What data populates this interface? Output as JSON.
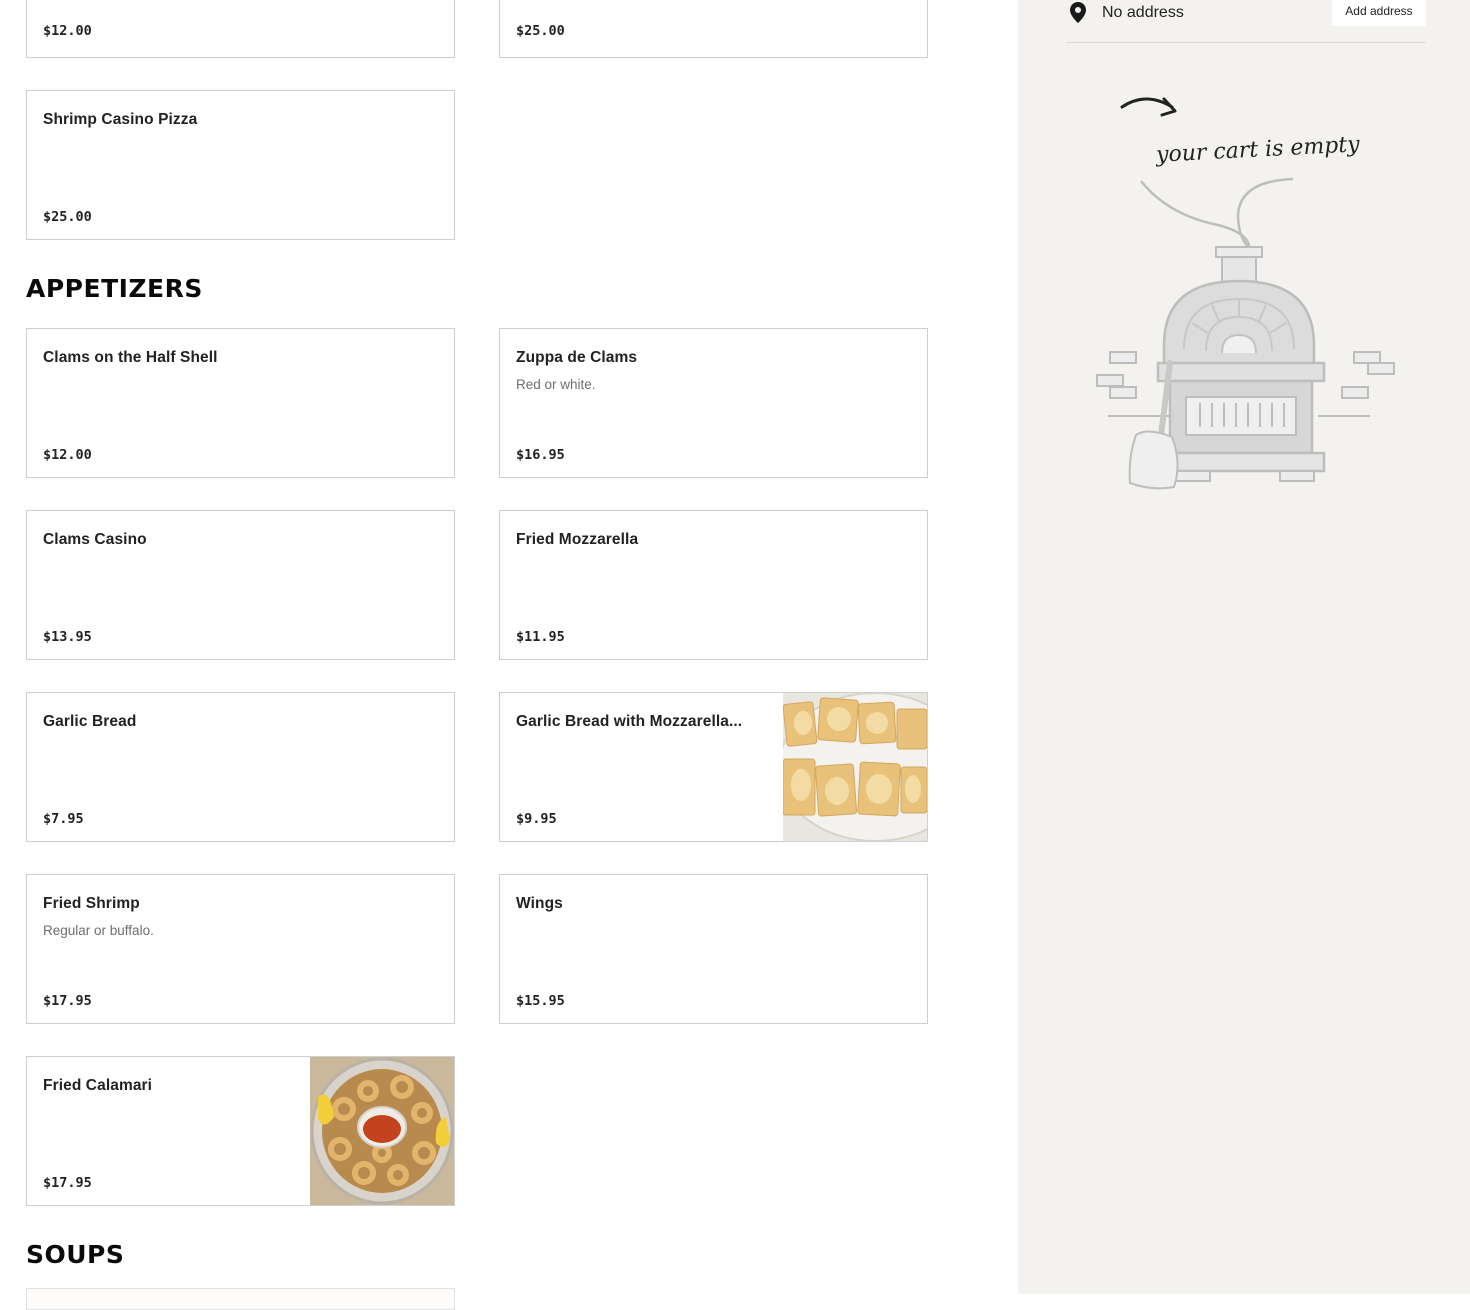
{
  "menu": {
    "top_items": [
      {
        "name": "",
        "description": "",
        "price": "$12.00"
      },
      {
        "name": "",
        "description": "",
        "price": "$25.00"
      },
      {
        "name": "Shrimp Casino Pizza",
        "description": "",
        "price": "$25.00"
      }
    ],
    "appetizers": {
      "title": "APPETIZERS",
      "items": [
        {
          "name": "Clams on the Half Shell",
          "description": "",
          "price": "$12.00"
        },
        {
          "name": "Zuppa de Clams",
          "description": "Red or white.",
          "price": "$16.95"
        },
        {
          "name": "Clams Casino",
          "description": "",
          "price": "$13.95"
        },
        {
          "name": "Fried Mozzarella",
          "description": "",
          "price": "$11.95"
        },
        {
          "name": "Garlic Bread",
          "description": "",
          "price": "$7.95"
        },
        {
          "name": "Garlic Bread with Mozzarella...",
          "description": "",
          "price": "$9.95",
          "image": "garlic-bread-photo"
        },
        {
          "name": "Fried Shrimp",
          "description": "Regular or buffalo.",
          "price": "$17.95"
        },
        {
          "name": "Wings",
          "description": "",
          "price": "$15.95"
        },
        {
          "name": "Fried Calamari",
          "description": "",
          "price": "$17.95",
          "image": "fried-calamari-photo"
        }
      ]
    },
    "soups": {
      "title": "SOUPS"
    }
  },
  "cart": {
    "address": "No address",
    "add_address_label": "Add address",
    "empty_message": "your cart is empty",
    "icons": {
      "location": "location-pin-icon",
      "illustration": "pizza-oven-illustration"
    }
  },
  "colors": {
    "sidebar_bg": "#f3f2ef",
    "card_border": "#cfcfcf",
    "text": "#222222"
  }
}
